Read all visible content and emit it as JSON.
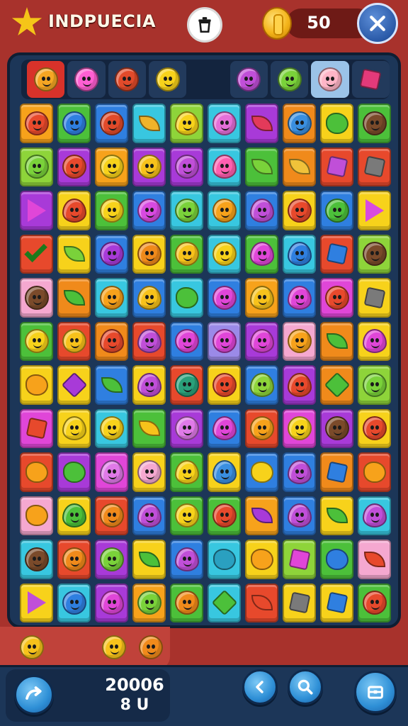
{
  "app": {
    "title": "INDPUECIA"
  },
  "header": {
    "coins": "50"
  },
  "footer": {
    "score": "20006",
    "level": "8 U"
  },
  "colors": {
    "background": "#a8322c",
    "board": "#1c3658",
    "accent_blue": "#2e8fd6",
    "coin_gold": "#f4b41a"
  },
  "icons": {
    "logo": "star-logo-icon",
    "trash": "trash-icon",
    "coin": "coin-icon",
    "close": "close-x-icon",
    "shuffle": "shuffle-arrow-icon",
    "back": "chevron-left-icon",
    "hint": "magnifier-icon",
    "menu": "chest-icon"
  },
  "tray_items": [
    {
      "kind": "face",
      "color": "#f5a623",
      "bg": "#d8322a"
    },
    {
      "kind": "face",
      "color": "#ff5fd2",
      "bg": "#223a5c"
    },
    {
      "kind": "face",
      "color": "#e14a2a",
      "bg": "#223a5c"
    },
    {
      "kind": "face",
      "color": "#f7d21b",
      "bg": "#223a5c"
    },
    {
      "kind": "empty"
    },
    {
      "kind": "face",
      "color": "#c04fd8",
      "bg": "#223a5c"
    },
    {
      "kind": "face",
      "color": "#7ad23a",
      "bg": "#223a5c"
    },
    {
      "kind": "face",
      "color": "#ffb5c7",
      "bg": "#9bc3e8"
    },
    {
      "kind": "cube",
      "color": "#e33a7a",
      "bg": "#223a5c"
    }
  ],
  "board": [
    [
      [
        "#f7a21b",
        "#e7492c",
        "face"
      ],
      [
        "#4cc03a",
        "#2f7fe0",
        "face"
      ],
      [
        "#2f7fe0",
        "#e14a2a",
        "face"
      ],
      [
        "#38c7e0",
        "#f0b32a",
        "leaf"
      ],
      [
        "#8ed43a",
        "#f7d21b",
        "drop"
      ],
      [
        "#38c7e0",
        "#e46fd8",
        "face"
      ],
      [
        "#a83ad8",
        "#e33a5a",
        "leaf"
      ],
      [
        "#f08a1b",
        "#3a8fe0",
        "face"
      ],
      [
        "#f7d21b",
        "#4cc03a",
        "blob"
      ],
      [
        "#4cc03a",
        "#7a4a2a",
        "face"
      ]
    ],
    [
      [
        "#8ed43a",
        "#7ad23a",
        "face"
      ],
      [
        "#a83ad8",
        "#e7492c",
        "face"
      ],
      [
        "#f7a21b",
        "#f7d21b",
        "face"
      ],
      [
        "#a83ad8",
        "#f7c21b",
        "face"
      ],
      [
        "#a83ad8",
        "#c04fd8",
        "face"
      ],
      [
        "#38c7e0",
        "#ff5fb0",
        "drop"
      ],
      [
        "#4cc03a",
        "#7ad23a",
        "leaf"
      ],
      [
        "#f08a1b",
        "#f0c23a",
        "leaf"
      ],
      [
        "#e7492c",
        "#c04fd8",
        "cube"
      ],
      [
        "#e7492c",
        "#7a7a7a",
        "cube"
      ]
    ],
    [
      [
        "#a83ad8",
        "#e046d8",
        "tri"
      ],
      [
        "#f7d21b",
        "#e7492c",
        "drop"
      ],
      [
        "#4cc03a",
        "#f7d21b",
        "face"
      ],
      [
        "#2f7fe0",
        "#d84ae0",
        "face"
      ],
      [
        "#38c7e0",
        "#7ad23a",
        "face"
      ],
      [
        "#38c7e0",
        "#f7a21b",
        "face"
      ],
      [
        "#2f7fe0",
        "#c04fd8",
        "drop"
      ],
      [
        "#f7d21b",
        "#e7492c",
        "face"
      ],
      [
        "#2f7fe0",
        "#4cc03a",
        "face"
      ],
      [
        "#f7d21b",
        "#d84ae0",
        "tri"
      ]
    ],
    [
      [
        "#e7492c",
        "#4cc03a",
        "check"
      ],
      [
        "#f7d21b",
        "#7ad23a",
        "leaf"
      ],
      [
        "#2f7fe0",
        "#a83ad8",
        "face"
      ],
      [
        "#f7d21b",
        "#f08a1b",
        "face"
      ],
      [
        "#4cc03a",
        "#f7c21b",
        "face"
      ],
      [
        "#38c7e0",
        "#f7d21b",
        "face"
      ],
      [
        "#4cc03a",
        "#e046d8",
        "drop"
      ],
      [
        "#38c7e0",
        "#2f7fe0",
        "drop"
      ],
      [
        "#e7492c",
        "#2f7fe0",
        "cube"
      ],
      [
        "#8ed43a",
        "#7a4a2a",
        "face"
      ]
    ],
    [
      [
        "#f5a8d0",
        "#7a4a2a",
        "face"
      ],
      [
        "#f08a1b",
        "#4cc03a",
        "leaf"
      ],
      [
        "#38c7e0",
        "#f7a21b",
        "face"
      ],
      [
        "#2f7fe0",
        "#f7c21b",
        "drop"
      ],
      [
        "#38c7e0",
        "#4cc03a",
        "blob"
      ],
      [
        "#2f7fe0",
        "#e046d8",
        "face"
      ],
      [
        "#f7a21b",
        "#f7c21b",
        "drop"
      ],
      [
        "#2f7fe0",
        "#e046d8",
        "drop"
      ],
      [
        "#e046d8",
        "#e7492c",
        "face"
      ],
      [
        "#f7d21b",
        "#7a7a7a",
        "cube"
      ]
    ],
    [
      [
        "#4cc03a",
        "#f7d21b",
        "face"
      ],
      [
        "#e7492c",
        "#f7c21b",
        "face"
      ],
      [
        "#f08a1b",
        "#e7492c",
        "drop"
      ],
      [
        "#e7492c",
        "#c04fd8",
        "drop"
      ],
      [
        "#2f7fe0",
        "#e046d8",
        "face"
      ],
      [
        "#9b8ae8",
        "#e046d8",
        "face"
      ],
      [
        "#a83ad8",
        "#e046d8",
        "drop"
      ],
      [
        "#f5a8d0",
        "#f7a21b",
        "face"
      ],
      [
        "#f08a1b",
        "#4cc03a",
        "leaf"
      ],
      [
        "#f7d21b",
        "#e046d8",
        "drop"
      ]
    ],
    [
      [
        "#f7d21b",
        "#f7a21b",
        "blob"
      ],
      [
        "#f7d21b",
        "#a83ad8",
        "diamond"
      ],
      [
        "#2f7fe0",
        "#4cc03a",
        "leaf"
      ],
      [
        "#f7d21b",
        "#c04fd8",
        "drop"
      ],
      [
        "#e7492c",
        "#2aa07a",
        "face"
      ],
      [
        "#f7d21b",
        "#e7492c",
        "face"
      ],
      [
        "#2f7fe0",
        "#8ed43a",
        "drop"
      ],
      [
        "#a83ad8",
        "#e7492c",
        "drop"
      ],
      [
        "#f08a1b",
        "#4cc03a",
        "diamond"
      ],
      [
        "#8ed43a",
        "#7ad23a",
        "face"
      ]
    ],
    [
      [
        "#e046d8",
        "#e7492c",
        "cube"
      ],
      [
        "#f7d21b",
        "#f7d21b",
        "drop"
      ],
      [
        "#38c7e0",
        "#f7d21b",
        "face"
      ],
      [
        "#4cc03a",
        "#f7c21b",
        "leaf"
      ],
      [
        "#a83ad8",
        "#e07ae8",
        "face"
      ],
      [
        "#2f7fe0",
        "#e046d8",
        "drop"
      ],
      [
        "#e7492c",
        "#f7a21b",
        "face"
      ],
      [
        "#e046d8",
        "#f7d21b",
        "face"
      ],
      [
        "#a83ad8",
        "#7a4a2a",
        "face"
      ],
      [
        "#f7d21b",
        "#e7492c",
        "face"
      ]
    ],
    [
      [
        "#e7492c",
        "#f7a21b",
        "blob"
      ],
      [
        "#a83ad8",
        "#4cc03a",
        "blob"
      ],
      [
        "#e046d8",
        "#e07ae8",
        "drop"
      ],
      [
        "#f7d21b",
        "#f5a8d0",
        "face"
      ],
      [
        "#4cc03a",
        "#f7d21b",
        "drop"
      ],
      [
        "#f7d21b",
        "#3a8fe0",
        "drop"
      ],
      [
        "#2f7fe0",
        "#f7d21b",
        "blob"
      ],
      [
        "#2f7fe0",
        "#c04fd8",
        "drop"
      ],
      [
        "#f08a1b",
        "#2f7fe0",
        "cube"
      ],
      [
        "#e7492c",
        "#f7a21b",
        "blob"
      ]
    ],
    [
      [
        "#f5a8d0",
        "#f7a21b",
        "blob"
      ],
      [
        "#f7d21b",
        "#4cc03a",
        "drop"
      ],
      [
        "#e7492c",
        "#f08a1b",
        "face"
      ],
      [
        "#2f7fe0",
        "#c04fd8",
        "drop"
      ],
      [
        "#4cc03a",
        "#f7d21b",
        "face"
      ],
      [
        "#4cc03a",
        "#e7492c",
        "face"
      ],
      [
        "#f7a21b",
        "#a83ad8",
        "leaf"
      ],
      [
        "#2f7fe0",
        "#c04fd8",
        "drop"
      ],
      [
        "#f7d21b",
        "#4cc03a",
        "leaf"
      ],
      [
        "#38c7e0",
        "#c04fd8",
        "drop"
      ]
    ],
    [
      [
        "#38c7e0",
        "#7a4a2a",
        "face"
      ],
      [
        "#e7492c",
        "#f08a1b",
        "face"
      ],
      [
        "#a83ad8",
        "#7ad23a",
        "face"
      ],
      [
        "#f7d21b",
        "#4cc03a",
        "leaf"
      ],
      [
        "#2f7fe0",
        "#c04fd8",
        "drop"
      ],
      [
        "#38c7e0",
        "#2aa0c0",
        "blob"
      ],
      [
        "#f7d21b",
        "#f7a21b",
        "blob"
      ],
      [
        "#8ed43a",
        "#e046d8",
        "cube"
      ],
      [
        "#4cc03a",
        "#2f7fe0",
        "blob"
      ],
      [
        "#f5a8d0",
        "#e7492c",
        "leaf"
      ]
    ],
    [
      [
        "#f7d21b",
        "#c04fd8",
        "tri"
      ],
      [
        "#38c7e0",
        "#2f7fe0",
        "face"
      ],
      [
        "#a83ad8",
        "#e046d8",
        "drop"
      ],
      [
        "#f7a21b",
        "#7ad23a",
        "face"
      ],
      [
        "#4cc03a",
        "#f08a1b",
        "face"
      ],
      [
        "#38c7e0",
        "#4cc03a",
        "diamond"
      ],
      [
        "#e7492c",
        "#e7492c",
        "leaf"
      ],
      [
        "#f7d21b",
        "#7a7a7a",
        "cube"
      ],
      [
        "#f7d21b",
        "#2f7fe0",
        "cube"
      ],
      [
        "#4cc03a",
        "#e7492c",
        "face"
      ]
    ]
  ],
  "bottom_tray": [
    {
      "color": "#f7c21b"
    },
    {
      "color": "#f7c21b"
    },
    {
      "color": "#f08a1b"
    }
  ]
}
